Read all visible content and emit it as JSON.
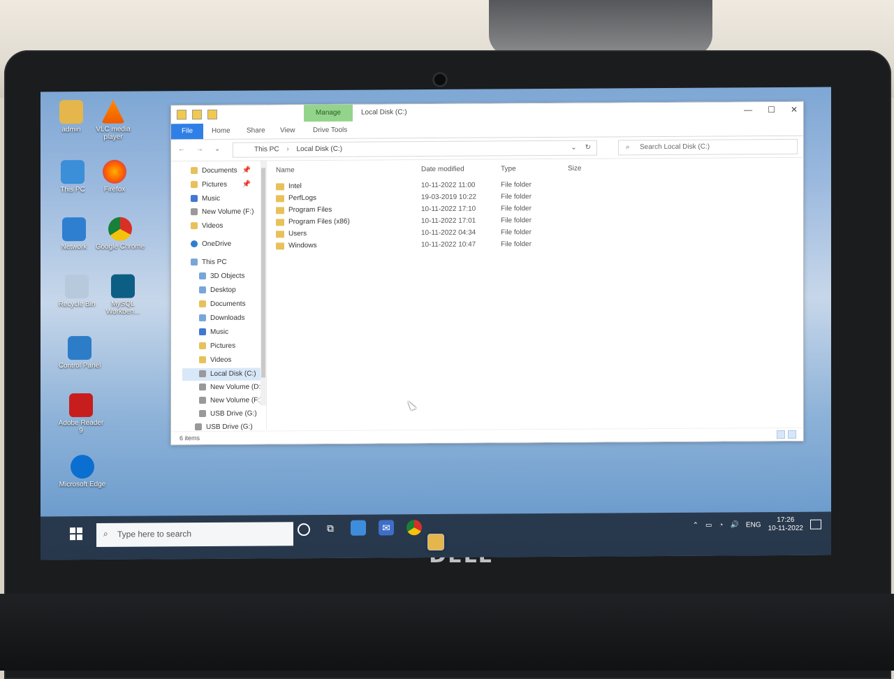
{
  "desktop": {
    "icons": [
      {
        "label": "admin",
        "icon": "user-folder-icon"
      },
      {
        "label": "VLC media player",
        "icon": "vlc-icon"
      },
      {
        "label": "This PC",
        "icon": "pc-icon"
      },
      {
        "label": "Firefox",
        "icon": "firefox-icon"
      },
      {
        "label": "Network",
        "icon": "network-icon"
      },
      {
        "label": "Google Chrome",
        "icon": "chrome-icon"
      },
      {
        "label": "Recycle Bin",
        "icon": "recycle-bin-icon"
      },
      {
        "label": "MySQL Workben...",
        "icon": "mysql-icon"
      },
      {
        "label": "Control Panel",
        "icon": "control-panel-icon"
      },
      {
        "label": "Adobe Reader 9",
        "icon": "adobe-reader-icon"
      },
      {
        "label": "Microsoft Edge",
        "icon": "edge-icon"
      }
    ]
  },
  "explorer": {
    "title": "Local Disk (C:)",
    "ribbon": {
      "manage_tab": "Manage",
      "file_tab": "File",
      "tabs": [
        "Home",
        "Share",
        "View",
        "Drive Tools"
      ]
    },
    "address": {
      "path": [
        "This PC",
        "Local Disk (C:)"
      ],
      "search_placeholder": "Search Local Disk (C:)"
    },
    "nav_pane": {
      "items": [
        {
          "label": "Documents",
          "pinned": true,
          "icon": "documents-icon"
        },
        {
          "label": "Pictures",
          "pinned": true,
          "icon": "pictures-icon"
        },
        {
          "label": "Music",
          "pinned": false,
          "icon": "music-icon"
        },
        {
          "label": "New Volume (F:)",
          "pinned": false,
          "icon": "drive-icon"
        },
        {
          "label": "Videos",
          "pinned": false,
          "icon": "videos-icon"
        },
        {
          "label": "OneDrive",
          "pinned": false,
          "icon": "onedrive-icon"
        },
        {
          "label": "This PC",
          "pinned": false,
          "icon": "pc-icon"
        },
        {
          "label": "3D Objects",
          "pinned": false,
          "icon": "3d-objects-icon"
        },
        {
          "label": "Desktop",
          "pinned": false,
          "icon": "desktop-icon"
        },
        {
          "label": "Documents",
          "pinned": false,
          "icon": "documents-icon"
        },
        {
          "label": "Downloads",
          "pinned": false,
          "icon": "downloads-icon"
        },
        {
          "label": "Music",
          "pinned": false,
          "icon": "music-icon"
        },
        {
          "label": "Pictures",
          "pinned": false,
          "icon": "pictures-icon"
        },
        {
          "label": "Videos",
          "pinned": false,
          "icon": "videos-icon"
        },
        {
          "label": "Local Disk (C:)",
          "pinned": false,
          "icon": "drive-icon",
          "selected": true
        },
        {
          "label": "New Volume (D:",
          "pinned": false,
          "icon": "drive-icon"
        },
        {
          "label": "New Volume (F:)",
          "pinned": false,
          "icon": "drive-icon"
        },
        {
          "label": "USB Drive (G:)",
          "pinned": false,
          "icon": "usb-drive-icon"
        },
        {
          "label": "USB Drive (G:)",
          "pinned": false,
          "icon": "usb-drive-icon"
        }
      ]
    },
    "columns": {
      "name": "Name",
      "date": "Date modified",
      "type": "Type",
      "size": "Size"
    },
    "rows": [
      {
        "name": "Intel",
        "date": "10-11-2022 11:00",
        "type": "File folder"
      },
      {
        "name": "PerfLogs",
        "date": "19-03-2019 10:22",
        "type": "File folder"
      },
      {
        "name": "Program Files",
        "date": "10-11-2022 17:10",
        "type": "File folder"
      },
      {
        "name": "Program Files (x86)",
        "date": "10-11-2022 17:01",
        "type": "File folder"
      },
      {
        "name": "Users",
        "date": "10-11-2022 04:34",
        "type": "File folder"
      },
      {
        "name": "Windows",
        "date": "10-11-2022 10:47",
        "type": "File folder"
      }
    ],
    "status": "6 items"
  },
  "taskbar": {
    "search_placeholder": "Type here to search",
    "language": "ENG",
    "time": "17:26",
    "date": "10-11-2022"
  },
  "hardware": {
    "brand": "DELL"
  }
}
